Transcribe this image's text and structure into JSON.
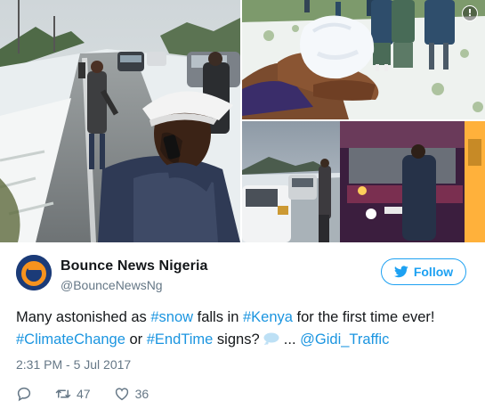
{
  "tweet": {
    "display_name": "Bounce News Nigeria",
    "handle": "@BounceNewsNg",
    "follow_label": "Follow",
    "text_parts": {
      "t1": "Many astonished as ",
      "h1": "#snow",
      "t2": " falls in ",
      "h2": "#Kenya",
      "t3": " for the first time ever!",
      "h3": "#ClimateChange",
      "t4": " or ",
      "h4": "#EndTime",
      "t5": " signs? ",
      "t6": " ... ",
      "m1": "@Gidi_Traffic"
    },
    "timestamp": "2:31 PM - 5 Jul 2017",
    "retweets": "47",
    "likes": "36"
  },
  "icons": {
    "info": "info-icon",
    "avatar": "bounce-logo",
    "follow": "twitter-bird-icon",
    "emoji": "speech-balloon-emoji",
    "reply": "reply-icon",
    "retweet": "retweet-icon",
    "like": "heart-icon"
  },
  "info_glyph": "!",
  "colors": {
    "link": "#1b95e0",
    "follow": "#1da1f2",
    "muted": "#657786",
    "text": "#14171a"
  }
}
